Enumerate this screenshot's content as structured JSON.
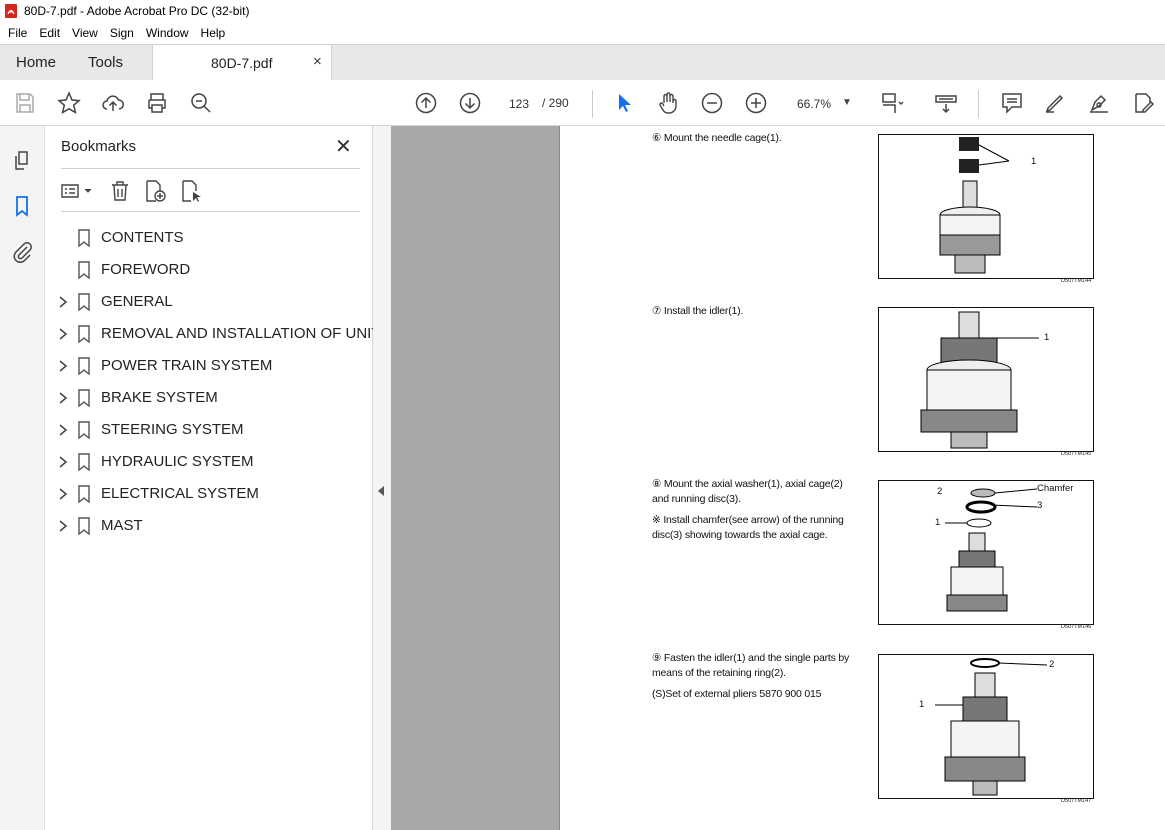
{
  "window": {
    "title": "80D-7.pdf - Adobe Acrobat Pro DC (32-bit)"
  },
  "menu": {
    "items": [
      "File",
      "Edit",
      "View",
      "Sign",
      "Window",
      "Help"
    ]
  },
  "tabs": {
    "home": "Home",
    "tools": "Tools",
    "doc": "80D-7.pdf"
  },
  "toolbar": {
    "page_current": "123",
    "page_total": "/ 290",
    "zoom": "66.7%"
  },
  "bookmarks": {
    "title": "Bookmarks",
    "items": [
      {
        "label": "CONTENTS",
        "expandable": false
      },
      {
        "label": "FOREWORD",
        "expandable": false
      },
      {
        "label": "GENERAL",
        "expandable": true
      },
      {
        "label": "REMOVAL AND INSTALLATION OF UNIT",
        "expandable": true
      },
      {
        "label": "POWER TRAIN SYSTEM",
        "expandable": true
      },
      {
        "label": "BRAKE SYSTEM",
        "expandable": true
      },
      {
        "label": "STEERING SYSTEM",
        "expandable": true
      },
      {
        "label": "HYDRAULIC SYSTEM",
        "expandable": true
      },
      {
        "label": "ELECTRICAL SYSTEM",
        "expandable": true
      },
      {
        "label": "MAST",
        "expandable": true
      }
    ]
  },
  "document": {
    "steps": [
      {
        "lines": [
          "⑥ Mount the needle cage(1)."
        ]
      },
      {
        "lines": [
          "⑦ Install the idler(1)."
        ]
      },
      {
        "lines": [
          "⑧ Mount the axial washer(1), axial cage(2)",
          "    and running disc(3).",
          "※ Install chamfer(see arrow) of the running",
          "    disc(3) showing towards the axial cage."
        ]
      },
      {
        "lines": [
          "⑨ Fasten the idler(1) and the single parts by",
          "    means of the retaining ring(2).",
          "    (S)Set of external pliers      5870 900 015"
        ]
      }
    ],
    "figures": [
      {
        "code": "D507TM144",
        "callouts": [
          "1"
        ]
      },
      {
        "code": "D507TM145",
        "callouts": [
          "1"
        ]
      },
      {
        "code": "D507TM146",
        "callouts": [
          "Chamfer",
          "2",
          "3",
          "1"
        ]
      },
      {
        "code": "D507TM147",
        "callouts": [
          "2",
          "1"
        ]
      }
    ]
  }
}
